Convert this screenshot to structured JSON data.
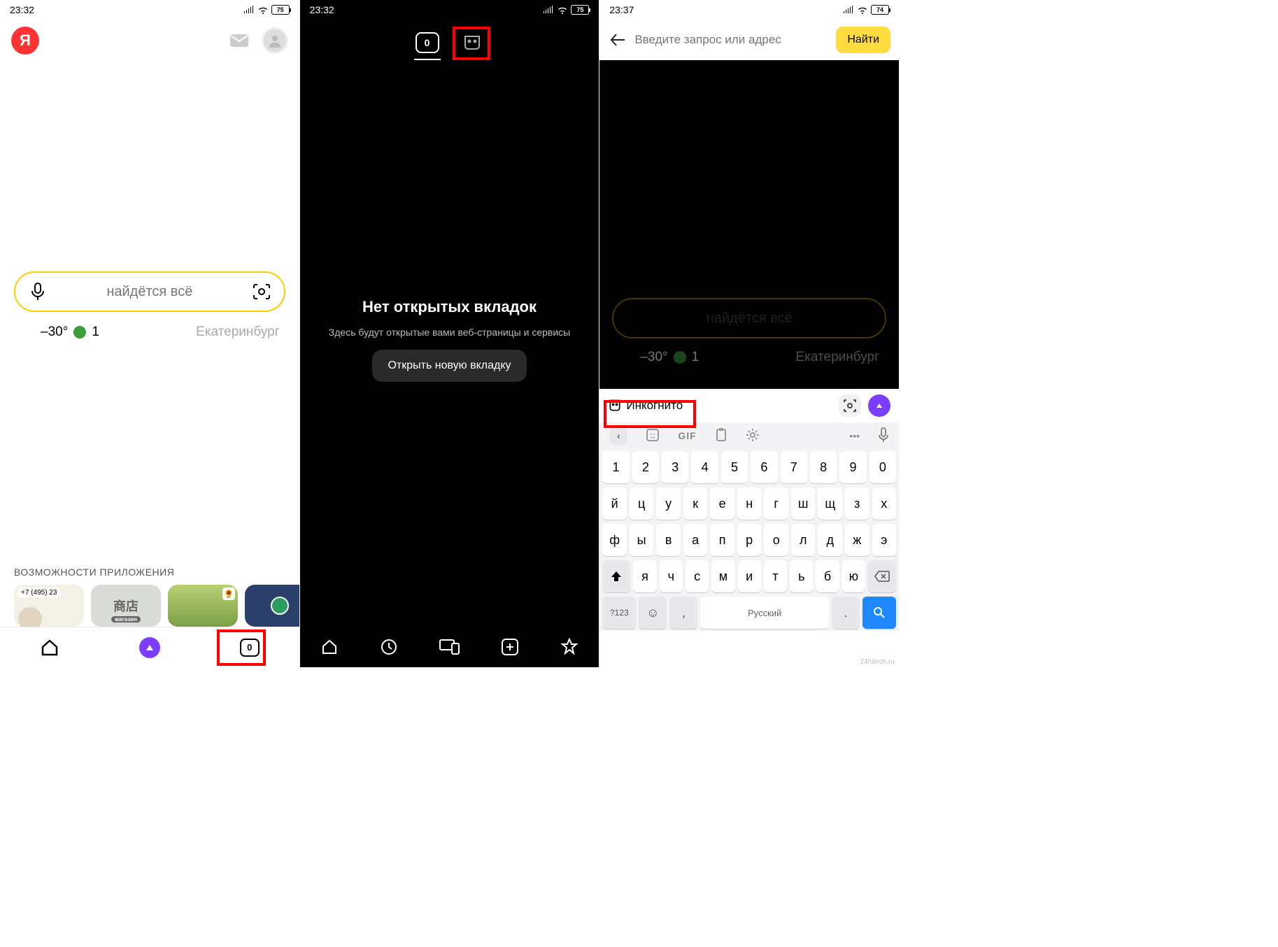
{
  "status": {
    "time1": "23:32",
    "time2": "23:32",
    "time3": "23:37",
    "battery1": "75",
    "battery2": "75",
    "battery3": "74"
  },
  "pane1": {
    "logo": "Я",
    "search_placeholder": "найдётся всё",
    "temp": "–30°",
    "traffic": "1",
    "city": "Екатеринбург",
    "features_title": "ВОЗМОЖНОСТИ ПРИЛОЖЕНИЯ",
    "phone_bubble": "+7 (495) 23",
    "translate_text": "商店",
    "translate_badge": "магазин",
    "sun_emoji": "🌻",
    "tab_count": "0"
  },
  "pane2": {
    "tab_count": "0",
    "title": "Нет открытых вкладок",
    "subtitle": "Здесь будут открытые вами веб-страницы и сервисы",
    "open_btn": "Открыть новую вкладку"
  },
  "pane3": {
    "url_placeholder": "Введите запрос или адрес",
    "find_btn": "Найти",
    "search_placeholder": "найдётся всё",
    "temp": "–30°",
    "traffic": "1",
    "city": "Екатеринбург",
    "incognito_chip": "Инкогнито",
    "kb_gif": "GIF",
    "kb_row1": [
      "1",
      "2",
      "3",
      "4",
      "5",
      "6",
      "7",
      "8",
      "9",
      "0"
    ],
    "kb_row2": [
      "й",
      "ц",
      "у",
      "к",
      "е",
      "н",
      "г",
      "ш",
      "щ",
      "з",
      "х"
    ],
    "kb_row3": [
      "ф",
      "ы",
      "в",
      "а",
      "п",
      "р",
      "о",
      "л",
      "д",
      "ж",
      "э"
    ],
    "kb_row4": [
      "я",
      "ч",
      "с",
      "м",
      "и",
      "т",
      "ь",
      "б",
      "ю"
    ],
    "kb_numkey": "?123",
    "kb_space": "Русский",
    "kb_comma": ",",
    "kb_dot": "."
  },
  "watermark": "24hitech.ru"
}
